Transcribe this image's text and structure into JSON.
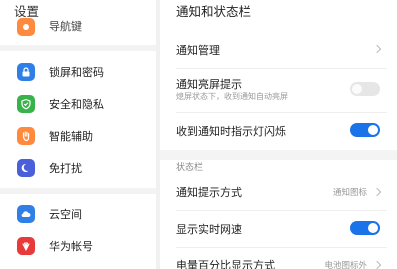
{
  "left": {
    "title": "设置",
    "items": [
      {
        "label": "导航键",
        "icon": "navigation-icon",
        "color": "#ff8a3d"
      },
      {
        "label": "锁屏和密码",
        "icon": "lock-icon",
        "color": "#2f7fe6"
      },
      {
        "label": "安全和隐私",
        "icon": "shield-icon",
        "color": "#38b24a"
      },
      {
        "label": "智能辅助",
        "icon": "hand-icon",
        "color": "#ff8a3d"
      },
      {
        "label": "免打扰",
        "icon": "moon-icon",
        "color": "#4a5fd8"
      },
      {
        "label": "云空间",
        "icon": "cloud-icon",
        "color": "#2f7fe6"
      },
      {
        "label": "华为帐号",
        "icon": "huawei-icon",
        "color": "#e83a3a"
      }
    ]
  },
  "right": {
    "title": "通知和状态栏",
    "rows": {
      "manage": {
        "label": "通知管理"
      },
      "wake": {
        "label": "通知亮屏提示",
        "sub": "熄屏状态下，收到通知自动亮屏",
        "on": false
      },
      "led": {
        "label": "收到通知时指示灯闪烁",
        "on": true
      },
      "section": "状态栏",
      "method": {
        "label": "通知提示方式",
        "value": "通知图标"
      },
      "speed": {
        "label": "显示实时网速",
        "on": true
      },
      "battery": {
        "label": "电量百分比显示方式",
        "value": "电池图标外"
      }
    }
  },
  "colors": {
    "accent": "#1a73e8",
    "toggle_off": "#e6e6e6"
  }
}
